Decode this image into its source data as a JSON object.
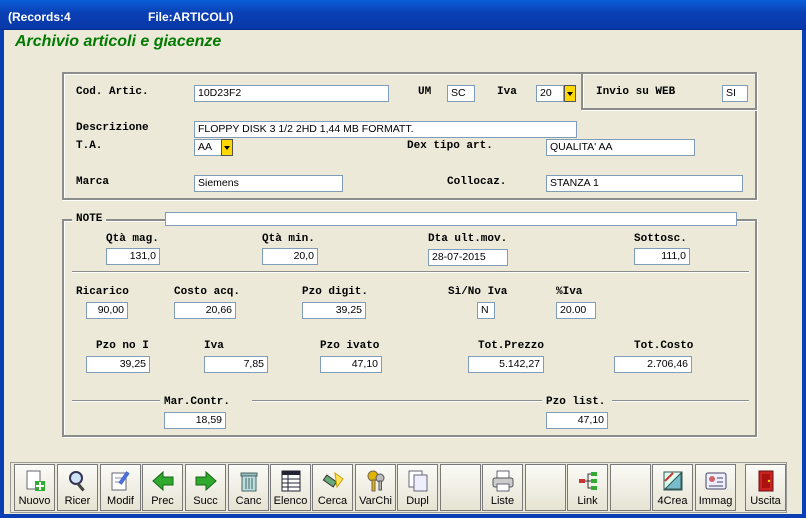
{
  "window": {
    "records": "(Records:4",
    "file": "File:ARTICOLI)"
  },
  "heading": "Archivio articoli e giacenze",
  "top": {
    "cod_label": "Cod. Artic.",
    "cod_value": "10D23F2",
    "um_label": "UM",
    "um_value": "SC",
    "iva_label": "Iva",
    "iva_value": "20",
    "web_label": "Invio su WEB",
    "web_value": "SI",
    "descr_label": "Descrizione",
    "descr_value": "FLOPPY DISK 3 1/2  2HD 1,44 MB  FORMATT.",
    "ta_label": "T.A.",
    "ta_value": "AA",
    "dex_label": "Dex tipo art.",
    "dex_value": "QUALITA' AA",
    "marca_label": "Marca",
    "marca_value": "Siemens",
    "colloc_label": "Collocaz.",
    "colloc_value": "STANZA 1"
  },
  "bottom": {
    "note_label": "NOTE",
    "note_value": "",
    "qta_mag_label": "Qtà mag.",
    "qta_mag_value": "131,0",
    "qta_min_label": "Qtà min.",
    "qta_min_value": "20,0",
    "dta_label": "Dta ult.mov.",
    "dta_value": "28-07-2015",
    "sottosc_label": "Sottosc.",
    "sottosc_value": "111,0",
    "ricarico_label": "Ricarico",
    "ricarico_value": "90,00",
    "costo_label": "Costo acq.",
    "costo_value": "20,66",
    "pzo_digit_label": "Pzo digit.",
    "pzo_digit_value": "39,25",
    "sino_label": "Sì/No Iva",
    "sino_value": "N",
    "piva_label": "%Iva",
    "piva_value": "20.00",
    "pzo_noi_label": "Pzo no I",
    "pzo_noi_value": "39,25",
    "iva2_label": "Iva",
    "iva2_value": "7,85",
    "pzo_ivato_label": "Pzo ivato",
    "pzo_ivato_value": "47,10",
    "tot_prezzo_label": "Tot.Prezzo",
    "tot_prezzo_value": "5.142,27",
    "tot_costo_label": "Tot.Costo",
    "tot_costo_value": "2.706,46",
    "mar_label": "Mar.Contr.",
    "mar_value": "18,59",
    "list_label": "Pzo list.",
    "list_value": "47,10"
  },
  "toolbar": [
    {
      "label": "Nuovo",
      "icon": "new-document-icon"
    },
    {
      "label": "Ricer",
      "icon": "magnifier-icon"
    },
    {
      "label": "Modif",
      "icon": "edit-document-icon"
    },
    {
      "label": "Prec",
      "icon": "arrow-left-icon"
    },
    {
      "label": "Succ",
      "icon": "arrow-right-icon"
    },
    {
      "label": "Canc",
      "icon": "trash-icon"
    },
    {
      "label": "Elenco",
      "icon": "list-icon"
    },
    {
      "label": "Cerca",
      "icon": "flashlight-icon"
    },
    {
      "label": "VarChi",
      "icon": "keys-icon"
    },
    {
      "label": "Dupl",
      "icon": "duplicate-icon"
    },
    {
      "label": "",
      "icon": ""
    },
    {
      "label": "Liste",
      "icon": "printer-icon"
    },
    {
      "label": "",
      "icon": ""
    },
    {
      "label": "Link",
      "icon": "link-tree-icon"
    },
    {
      "label": "",
      "icon": ""
    },
    {
      "label": "4Crea",
      "icon": "create-tools-icon"
    },
    {
      "label": "Immag",
      "icon": "image-card-icon"
    },
    {
      "label": "",
      "icon": ""
    },
    {
      "label": "Uscita",
      "icon": "exit-door-icon"
    }
  ],
  "colors": {
    "title_bar": "#0a3fb4",
    "heading_green": "#007a00",
    "dropdown_yellow": "#ffd800"
  }
}
